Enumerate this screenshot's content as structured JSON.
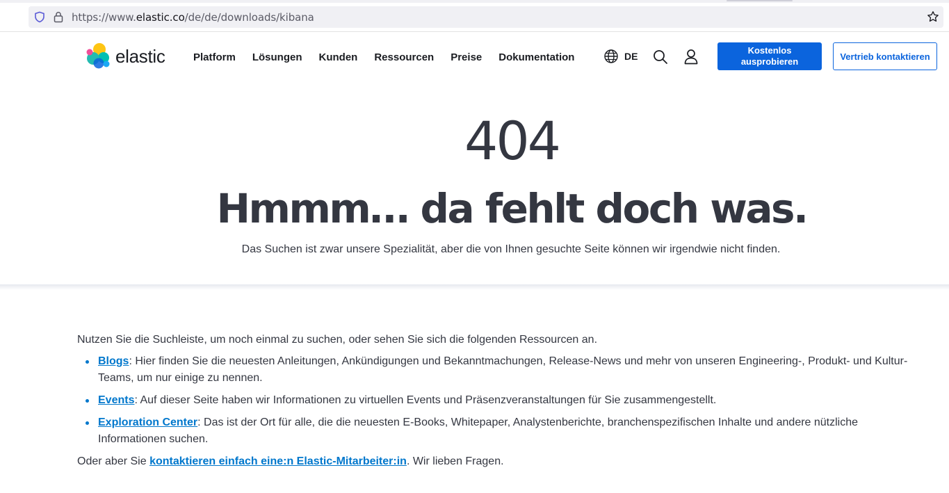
{
  "browser": {
    "url_prefix": "https://www.",
    "url_host": "elastic.co",
    "url_path": "/de/de/downloads/kibana"
  },
  "header": {
    "logo_text": "elastic",
    "nav": [
      "Platform",
      "Lösungen",
      "Kunden",
      "Ressourcen",
      "Preise",
      "Dokumentation"
    ],
    "language": "DE",
    "cta_primary": "Kostenlos ausprobieren",
    "cta_secondary": "Vertrieb kontaktieren"
  },
  "hero": {
    "code": "404",
    "headline": "Hmmm… da fehlt doch was.",
    "subline": "Das Suchen ist zwar unsere Spezialität, aber die von Ihnen gesuchte Seite können wir irgendwie nicht finden."
  },
  "content": {
    "intro": "Nutzen Sie die Suchleiste, um noch einmal zu suchen, oder sehen Sie sich die folgenden Ressourcen an.",
    "resources": [
      {
        "link": "Blogs",
        "text": ": Hier finden Sie die neuesten Anleitungen, Ankündigungen und Bekanntmachungen, Release-News und mehr von unseren Engineering-, Produkt- und Kultur-Teams, um nur einige zu nennen."
      },
      {
        "link": "Events",
        "text": ": Auf dieser Seite haben wir Informationen zu virtuellen Events und Präsenzveranstaltungen für Sie zusammengestellt."
      },
      {
        "link": "Exploration Center",
        "text": ": Das ist der Ort für alle, die die neuesten E-Books, Whitepaper, Analystenberichte, branchenspezifischen Inhalte und andere nützliche Informationen suchen."
      }
    ],
    "outro_prefix": "Oder aber Sie ",
    "outro_link": "kontaktieren einfach eine:n Elastic-Mitarbeiter:in",
    "outro_suffix": ". Wir lieben Fragen."
  },
  "colors": {
    "accent": "#0b64dd",
    "link": "#0077cc",
    "text": "#343741"
  }
}
